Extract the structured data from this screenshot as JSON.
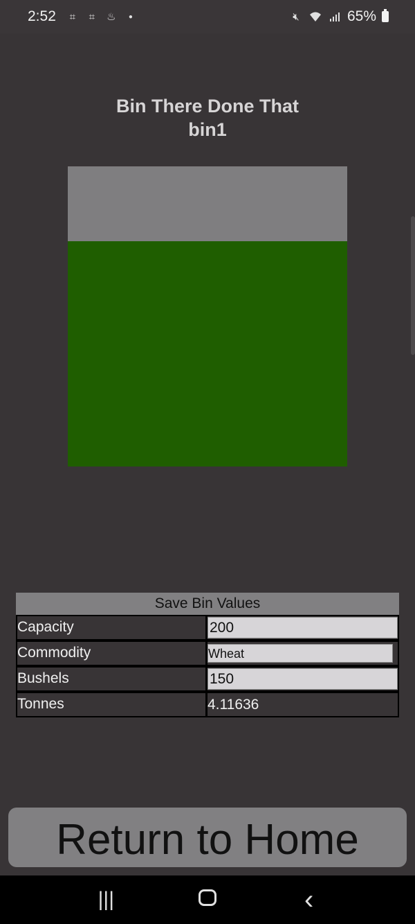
{
  "status_bar": {
    "time": "2:52",
    "left_icons": [
      "screenshot-icon",
      "screenshot-icon",
      "app-notification-icon",
      "dot-icon"
    ],
    "right_icons": [
      "mute-icon",
      "wifi-icon",
      "signal-icon"
    ],
    "battery": "65%"
  },
  "header": {
    "title": "Bin There Done That",
    "bin_name": "bin1"
  },
  "bin": {
    "fill_fraction": 0.75,
    "fill_color": "#1f5e00",
    "empty_color": "#7f7e80"
  },
  "table": {
    "save_label": "Save Bin Values",
    "rows": [
      {
        "label": "Capacity",
        "value": "200"
      },
      {
        "label": "Commodity",
        "value": "Wheat"
      },
      {
        "label": "Bushels",
        "value": "150"
      },
      {
        "label": "Tonnes",
        "value": "4.11636"
      }
    ]
  },
  "home_button_label": "Return to Home",
  "nav": {
    "recent": "|||",
    "back": "‹"
  }
}
